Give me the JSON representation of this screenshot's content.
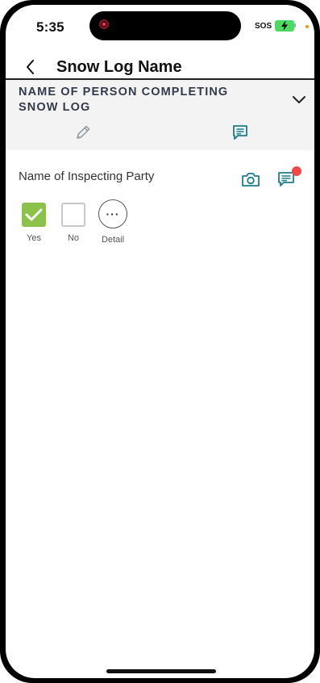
{
  "status_bar": {
    "time": "5:35",
    "carrier": "SOS",
    "battery_color": "#4cd964"
  },
  "header": {
    "back_icon": "chevron-left-icon",
    "title": "Snow Log Name"
  },
  "section": {
    "title": "NAME OF PERSON COMPLETING SNOW LOG",
    "collapse_icon": "chevron-down-icon",
    "edit_icon": "pencil-icon",
    "comment_icon": "comment-icon",
    "background": "#f3f3f4"
  },
  "question": {
    "label": "Name of Inspecting Party",
    "camera_icon": "camera-icon",
    "comment_icon": "comment-icon",
    "has_notification": true,
    "options": [
      {
        "label": "Yes",
        "checked": true
      },
      {
        "label": "No",
        "checked": false
      },
      {
        "label": "Detail",
        "glyph": "···"
      }
    ]
  },
  "colors": {
    "accent_teal": "#1f7c8c",
    "check_green": "#8bc34a",
    "notification_red": "#f04848"
  }
}
